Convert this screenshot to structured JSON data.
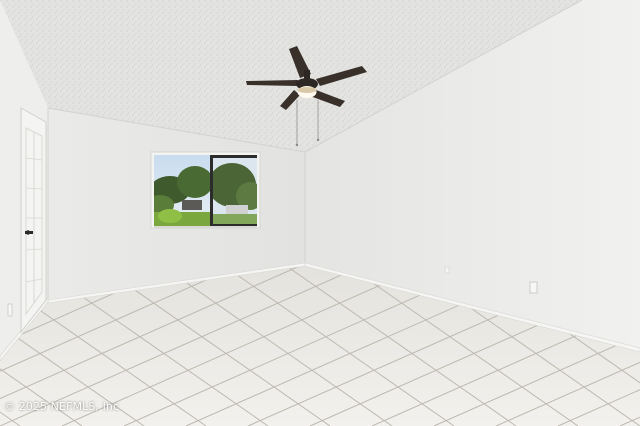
{
  "photo": {
    "watermark": "© 2025 NEFMLS, Inc",
    "colors": {
      "ceiling": "#e4e4e2",
      "left_wall": "#ededeb",
      "back_wall": "#e7e7e5",
      "right_wall": "#ebebea",
      "floor_tile": "#ecebe7",
      "grout": "#b9b6ae",
      "fan_blade": "#3a302a"
    },
    "objects": [
      "ceiling-fan",
      "window",
      "door",
      "tile-floor",
      "light-switch",
      "outlet"
    ]
  }
}
